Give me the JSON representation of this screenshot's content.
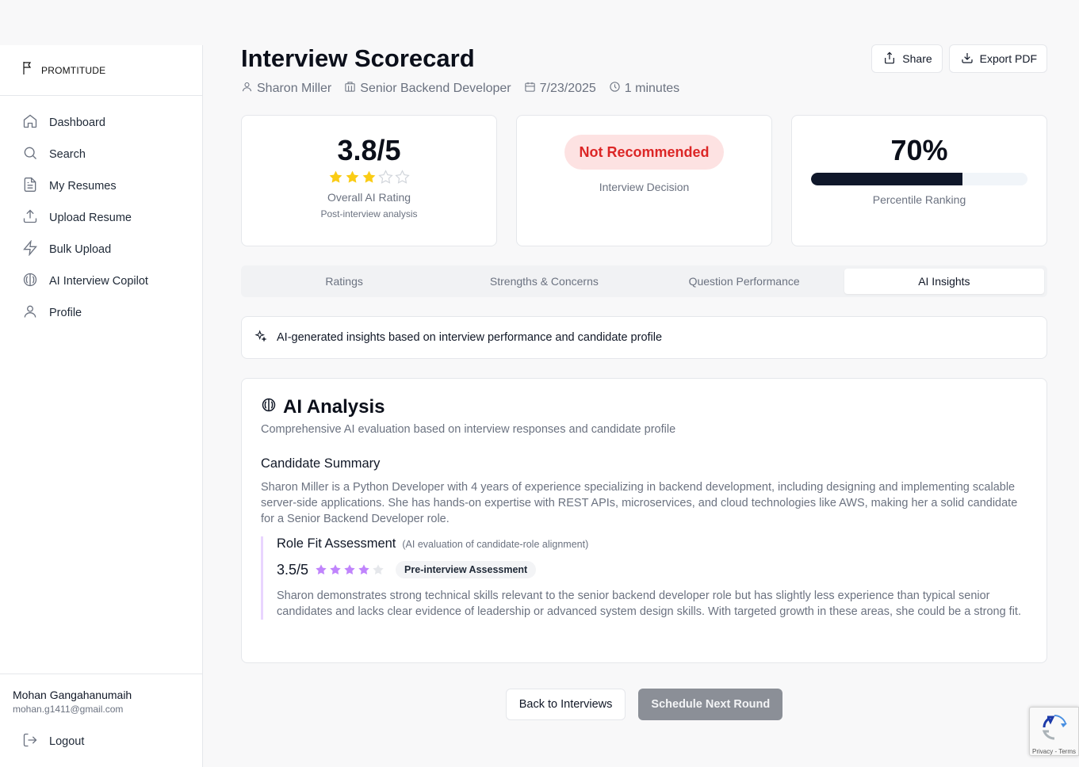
{
  "brand": {
    "name": "PROMTITUDE",
    "icon": "flag-icon"
  },
  "sidebar": {
    "items": [
      {
        "label": "Dashboard",
        "icon": "home-icon"
      },
      {
        "label": "Search",
        "icon": "search-icon"
      },
      {
        "label": "My Resumes",
        "icon": "file-text-icon"
      },
      {
        "label": "Upload Resume",
        "icon": "upload-icon"
      },
      {
        "label": "Bulk Upload",
        "icon": "zap-icon"
      },
      {
        "label": "AI Interview Copilot",
        "icon": "brain-icon"
      },
      {
        "label": "Profile",
        "icon": "user-icon"
      }
    ],
    "user": {
      "name": "Mohan Gangahanumaih",
      "email": "mohan.g1411@gmail.com"
    },
    "logout_label": "Logout"
  },
  "header": {
    "title": "Interview Scorecard",
    "candidate": "Sharon Miller",
    "role": "Senior Backend Developer",
    "date": "7/23/2025",
    "duration": "1 minutes",
    "share_label": "Share",
    "export_label": "Export PDF"
  },
  "cards": {
    "rating": {
      "value": "3.8/5",
      "stars": 3,
      "max_stars": 5,
      "label": "Overall AI Rating",
      "sub": "Post-interview analysis"
    },
    "decision": {
      "value": "Not Recommended",
      "label": "Interview Decision"
    },
    "percentile": {
      "value": "70%",
      "fill": 0.7,
      "label": "Percentile Ranking"
    }
  },
  "tabs": [
    {
      "label": "Ratings",
      "active": false
    },
    {
      "label": "Strengths & Concerns",
      "active": false
    },
    {
      "label": "Question Performance",
      "active": false
    },
    {
      "label": "AI Insights",
      "active": true
    }
  ],
  "notice": {
    "text": "AI-generated insights based on interview performance and candidate profile",
    "icon": "sparkles-icon"
  },
  "analysis": {
    "title": "AI Analysis",
    "description": "Comprehensive AI evaluation based on interview responses and candidate profile",
    "summary_heading": "Candidate Summary",
    "summary": "Sharon Miller is a Python Developer with 4 years of experience specializing in backend development, including designing and implementing scalable server-side applications. She has hands-on expertise with REST APIs, microservices, and cloud technologies like AWS, making her a solid candidate for a Senior Backend Developer role.",
    "role_fit": {
      "title": "Role Fit Assessment",
      "note": "(AI evaluation of candidate-role alignment)",
      "score": "3.5/5",
      "stars": 4,
      "max_stars": 5,
      "badge": "Pre-interview Assessment",
      "text": "Sharon demonstrates strong technical skills relevant to the senior backend developer role but has slightly less experience than typical senior candidates and lacks clear evidence of leadership or advanced system design skills. With targeted growth in these areas, she could be a strong fit."
    }
  },
  "actions": {
    "back_label": "Back to Interviews",
    "next_label": "Schedule Next Round"
  },
  "recaptcha": {
    "text": "Privacy - Terms"
  },
  "colors": {
    "star_gold": "#facc15",
    "star_purple": "#c084fc",
    "star_empty": "#e5e7eb",
    "decision_red": "#dc2626"
  }
}
